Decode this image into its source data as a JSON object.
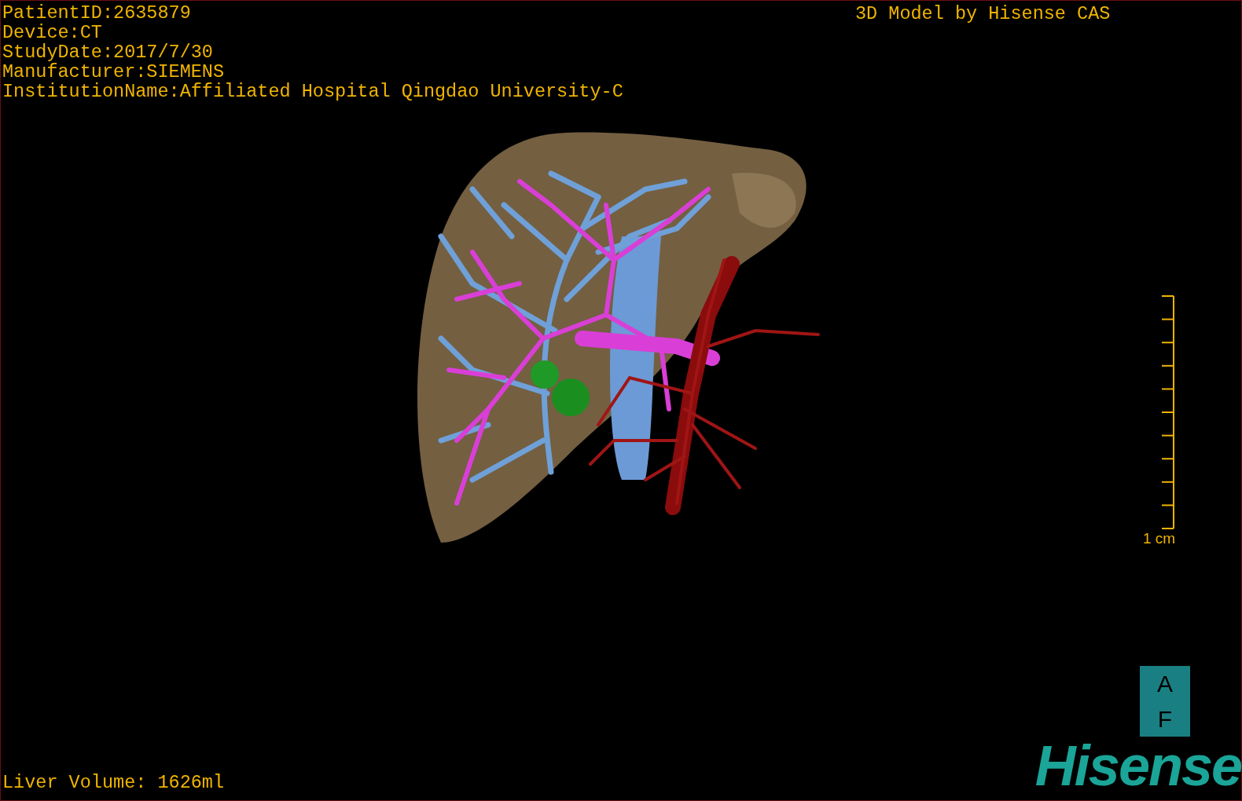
{
  "patient_info": [
    "PatientID:2635879",
    "Device:CT",
    "StudyDate:2017/7/30",
    "Manufacturer:SIEMENS",
    "InstitutionName:Affiliated Hospital Qingdao University-C"
  ],
  "model_caption": "3D Model by Hisense CAS",
  "scale_bar": {
    "label": "1 cm"
  },
  "orientation": [
    "A",
    "F"
  ],
  "liver_volume": "Liver Volume: 1626ml",
  "logo": "Hisense"
}
